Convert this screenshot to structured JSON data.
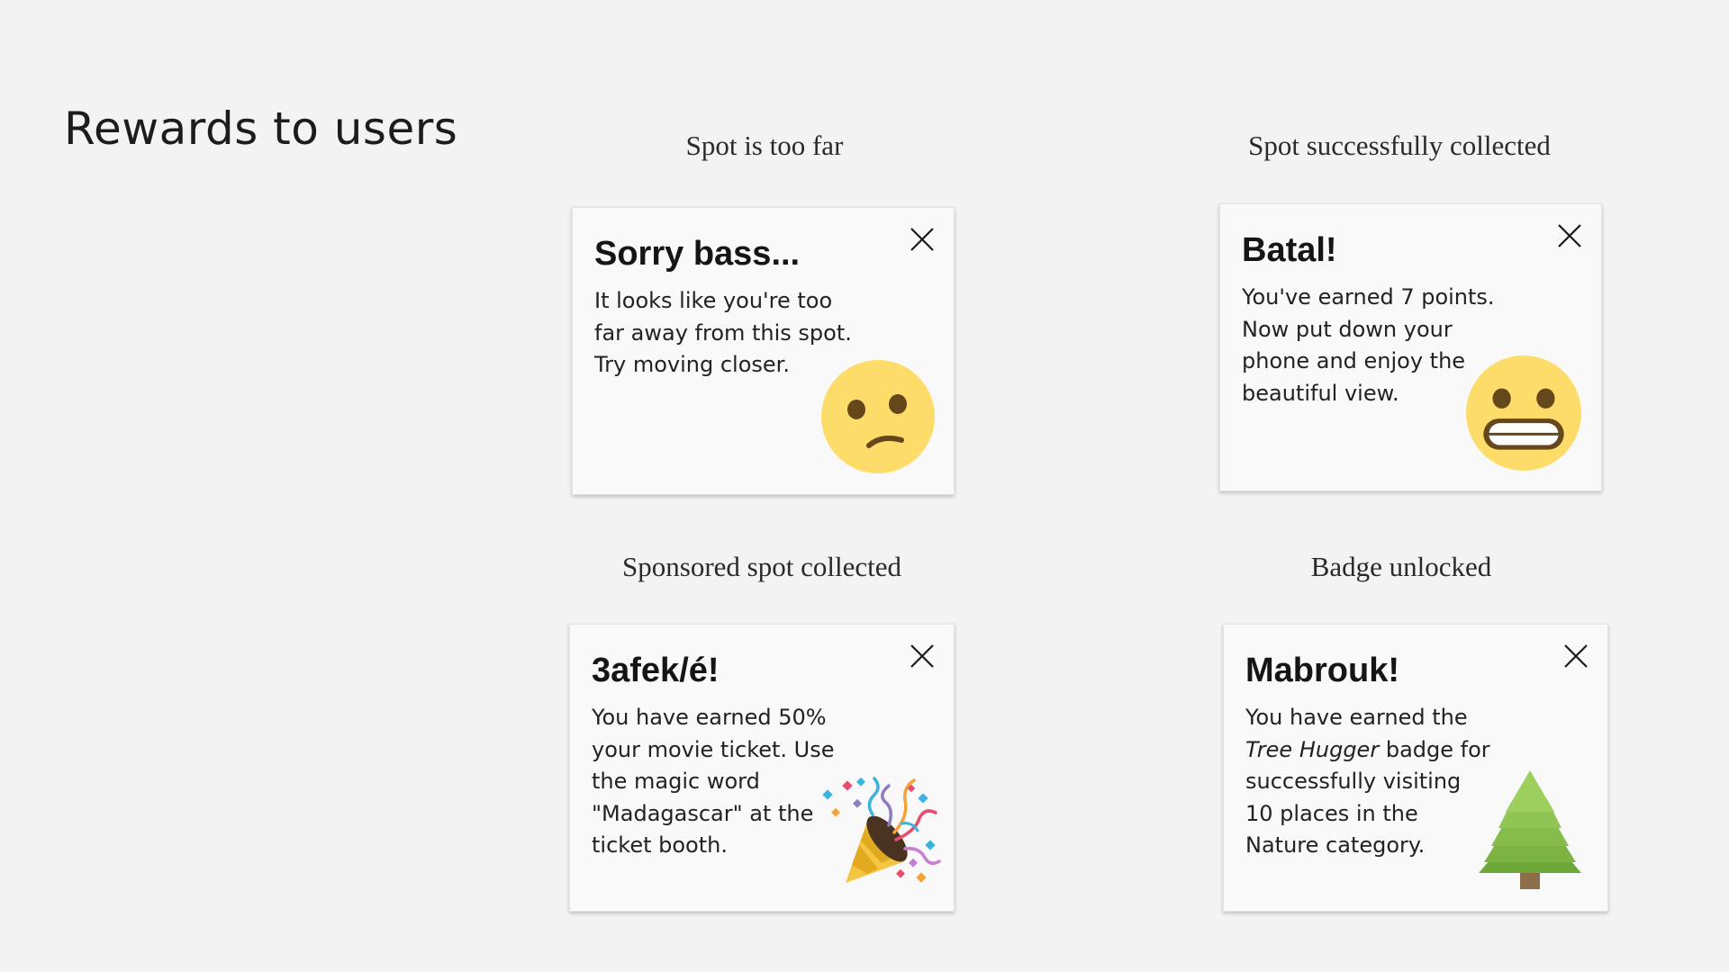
{
  "page": {
    "title": "Rewards to users"
  },
  "sections": {
    "too_far": {
      "label": "Spot is too far",
      "card": {
        "title": "Sorry bass...",
        "body_lines": [
          "It looks like you're too",
          "far away from this spot.",
          "Try moving closer."
        ],
        "icon": "confused-face-emoji"
      }
    },
    "collected": {
      "label": "Spot successfully collected",
      "card": {
        "title": "Batal!",
        "body_lines": [
          "You've earned 7 points.",
          "Now put down your",
          "phone and enjoy the",
          "beautiful view."
        ],
        "icon": "grimacing-face-emoji"
      }
    },
    "sponsored": {
      "label": "Sponsored spot collected",
      "card": {
        "title": "3afek/é!",
        "body_lines": [
          "You have earned 50%",
          "your movie ticket. Use",
          "the magic word",
          "\"Madagascar\" at the",
          "ticket booth."
        ],
        "icon": "party-popper-emoji"
      }
    },
    "badge": {
      "label": "Badge unlocked",
      "card": {
        "title": "Mabrouk!",
        "body_lines": [
          "You have earned the",
          "badge for",
          "successfully visiting",
          "10 places in the",
          "Nature category."
        ],
        "badge_name": "Tree Hugger",
        "icon": "evergreen-tree-emoji"
      }
    }
  },
  "colors": {
    "background": "#f3f3f3",
    "card": "#f9f9f9",
    "emoji_face": "#fddc6a",
    "emoji_features": "#65471b",
    "tree": "#7cb342",
    "trunk": "#8d6e4a"
  }
}
